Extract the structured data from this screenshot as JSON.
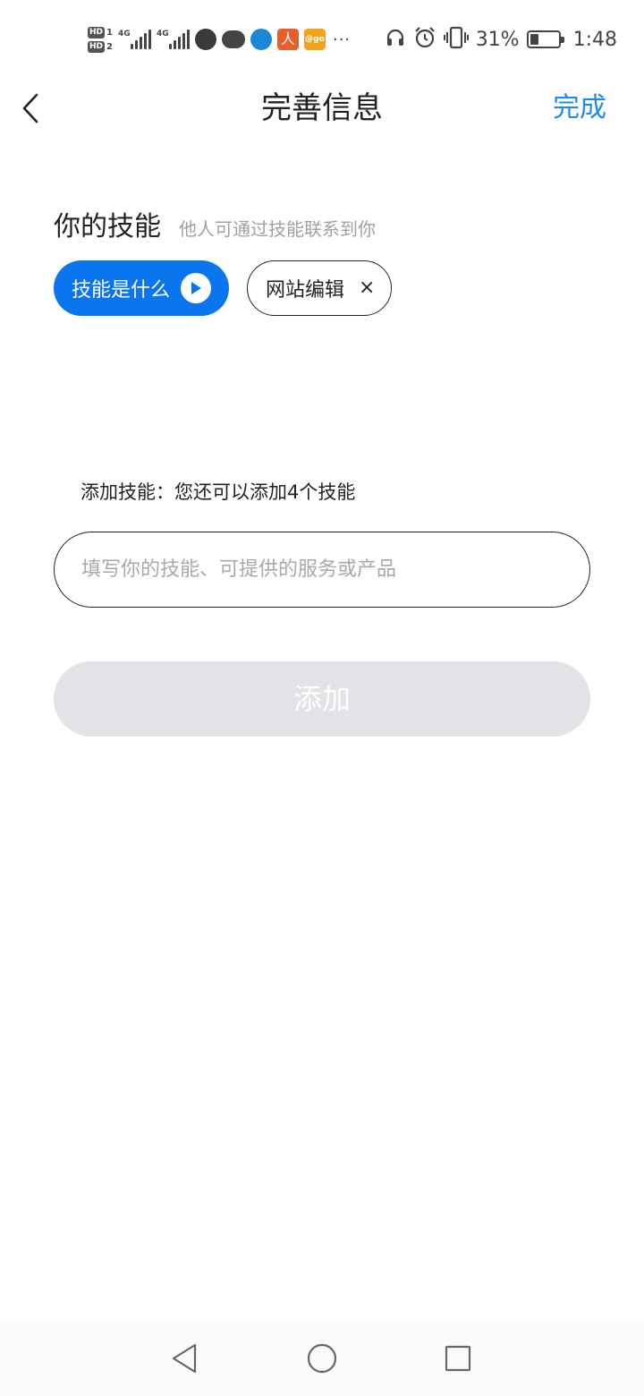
{
  "status_bar": {
    "sim1_label": "HD",
    "sim2_label": "HD",
    "net1": "4G",
    "net2": "4G",
    "app_icon_orange": "人",
    "app_icon_yellow": "@go",
    "more_dots": "···",
    "battery_percent": "31%",
    "battery_level": 0.31,
    "time": "1:48",
    "icons": [
      "headphone-icon",
      "alarm-icon",
      "vibrate-icon",
      "battery-icon"
    ]
  },
  "nav": {
    "title": "完善信息",
    "done_label": "完成",
    "accent_color": "#1c8ce8"
  },
  "skills": {
    "title": "你的技能",
    "subtitle": "他人可通过技能联系到你",
    "what_chip_label": "技能是什么",
    "tags": [
      {
        "label": "网站编辑",
        "remove": "×"
      }
    ],
    "primary_color": "#0b74ef"
  },
  "add": {
    "hint": "添加技能：您还可以添加4个技能",
    "input_value": "",
    "input_placeholder": "填写你的技能、可提供的服务或产品",
    "button_label": "添加"
  },
  "system_nav": {
    "buttons": [
      "back-triangle-icon",
      "home-circle-icon",
      "recents-square-icon"
    ]
  }
}
